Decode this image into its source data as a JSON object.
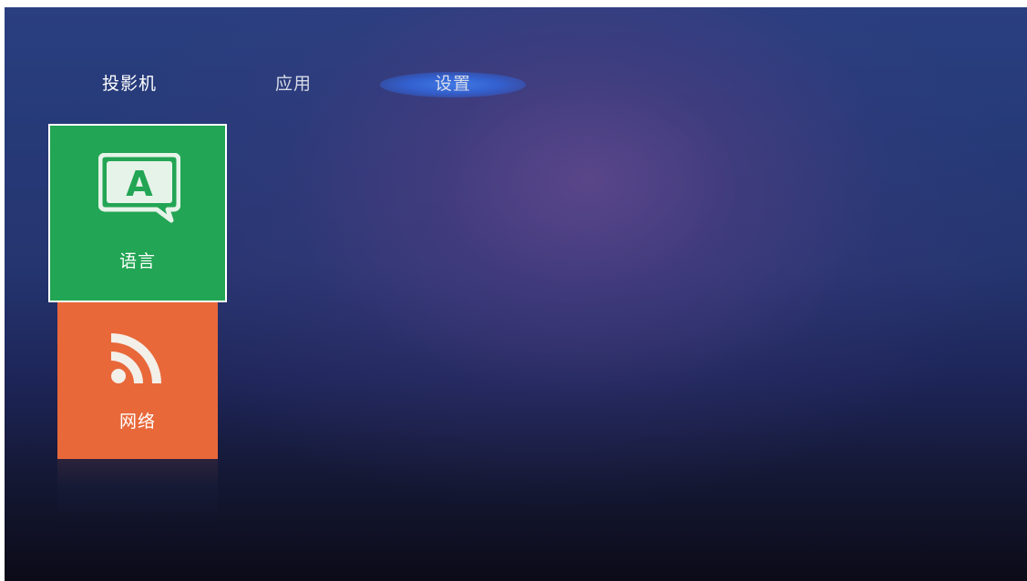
{
  "tabs": [
    {
      "label": "投影机"
    },
    {
      "label": "应用"
    },
    {
      "label": "设置",
      "selected": true
    }
  ],
  "tiles": [
    {
      "label": "语言",
      "icon": "language-icon",
      "color": "#22a554",
      "focused": true,
      "icon_letter": "A"
    },
    {
      "label": "网络",
      "icon": "rss-icon",
      "color": "#e8683a"
    }
  ],
  "colors": {
    "selected_tab_glow": "#3c70dc",
    "background_top": "#2a3f80",
    "background_bottom": "#0c0b18"
  }
}
